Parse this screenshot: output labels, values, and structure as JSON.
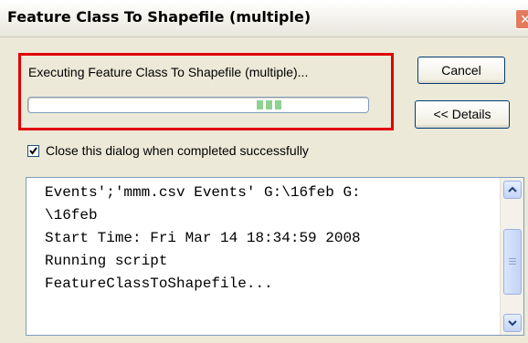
{
  "window": {
    "title": "Feature Class To Shapefile (multiple)",
    "close_icon": "close-icon"
  },
  "progress": {
    "status_text": "Executing Feature Class To Shapefile (multiple)...",
    "indeterminate": true,
    "indicator_color": "#8fd18f"
  },
  "buttons": {
    "cancel_label": "Cancel",
    "details_label": "<< Details"
  },
  "options": {
    "close_when_done_label": "Close this dialog when completed successfully",
    "close_when_done_checked": true
  },
  "log": {
    "lines": [
      "Events';'mmm.csv Events' G:\\16feb G:",
      "\\16feb",
      "Start Time: Fri Mar 14 18:34:59 2008",
      "Running script",
      "FeatureClassToShapefile..."
    ]
  },
  "colors": {
    "highlight": "#e00000",
    "dialog_bg": "#ece9d8"
  }
}
